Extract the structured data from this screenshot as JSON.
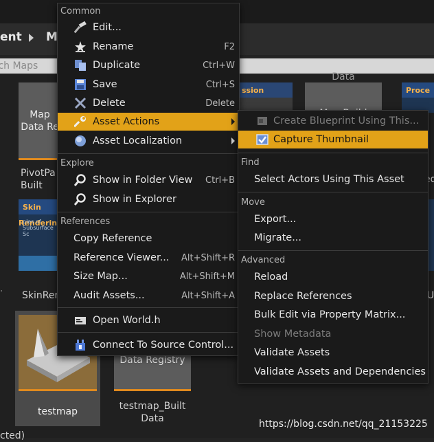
{
  "browser": {
    "breadcrumb_left": "ent",
    "breadcrumb_right": "M",
    "search_placeholder": "rch Maps"
  },
  "tiles": {
    "map_data_a": "Map\nData Re",
    "pivot_label": "PivotPa\nBuilt",
    "skin_label": "SkinRen",
    "skin_slide_title": "Skin Rendering",
    "skin_slide_sub": "ples of Subsurface Sc",
    "top_slide_title": "ssion",
    "right_slide_title": "Proce",
    "far_right_u": "U",
    "far_right_ed": "ed",
    "top_data": "Data",
    "map_build": "Map Build",
    "data_registry": "Data Registry",
    "testmap_label": "testmap",
    "testmap_built_label": "testmap_Built\nData",
    "left_ellipsis": ".",
    "bottom_fragment": "cted)"
  },
  "watermark": "https://blog.csdn.net/qq_21153225",
  "menu": {
    "common_header": "Common",
    "edit": "Edit...",
    "rename": "Rename",
    "rename_sc": "F2",
    "duplicate": "Duplicate",
    "duplicate_sc": "Ctrl+W",
    "save": "Save",
    "save_sc": "Ctrl+S",
    "delete": "Delete",
    "delete_sc": "Delete",
    "asset_actions": "Asset Actions",
    "asset_localization": "Asset Localization",
    "explore_header": "Explore",
    "show_folder": "Show in Folder View",
    "show_folder_sc": "Ctrl+B",
    "show_explorer": "Show in Explorer",
    "references_header": "References",
    "copy_reference": "Copy Reference",
    "reference_viewer": "Reference Viewer...",
    "reference_viewer_sc": "Alt+Shift+R",
    "size_map": "Size Map...",
    "size_map_sc": "Alt+Shift+M",
    "audit_assets": "Audit Assets...",
    "audit_assets_sc": "Alt+Shift+A",
    "open_world": "Open World.h",
    "connect_source": "Connect To Source Control..."
  },
  "submenu": {
    "create_blueprint": "Create Blueprint Using This...",
    "capture_thumbnail": "Capture Thumbnail",
    "find_header": "Find",
    "select_actors": "Select Actors Using This Asset",
    "move_header": "Move",
    "export": "Export...",
    "migrate": "Migrate...",
    "advanced_header": "Advanced",
    "reload": "Reload",
    "replace_references": "Replace References",
    "bulk_edit": "Bulk Edit via Property Matrix...",
    "show_metadata": "Show Metadata",
    "validate_assets": "Validate Assets",
    "validate_deps": "Validate Assets and Dependencies"
  },
  "colors": {
    "highlight": "#e2a218",
    "menu_bg": "#1a1a1a",
    "accent_orange": "#e08a1e"
  }
}
